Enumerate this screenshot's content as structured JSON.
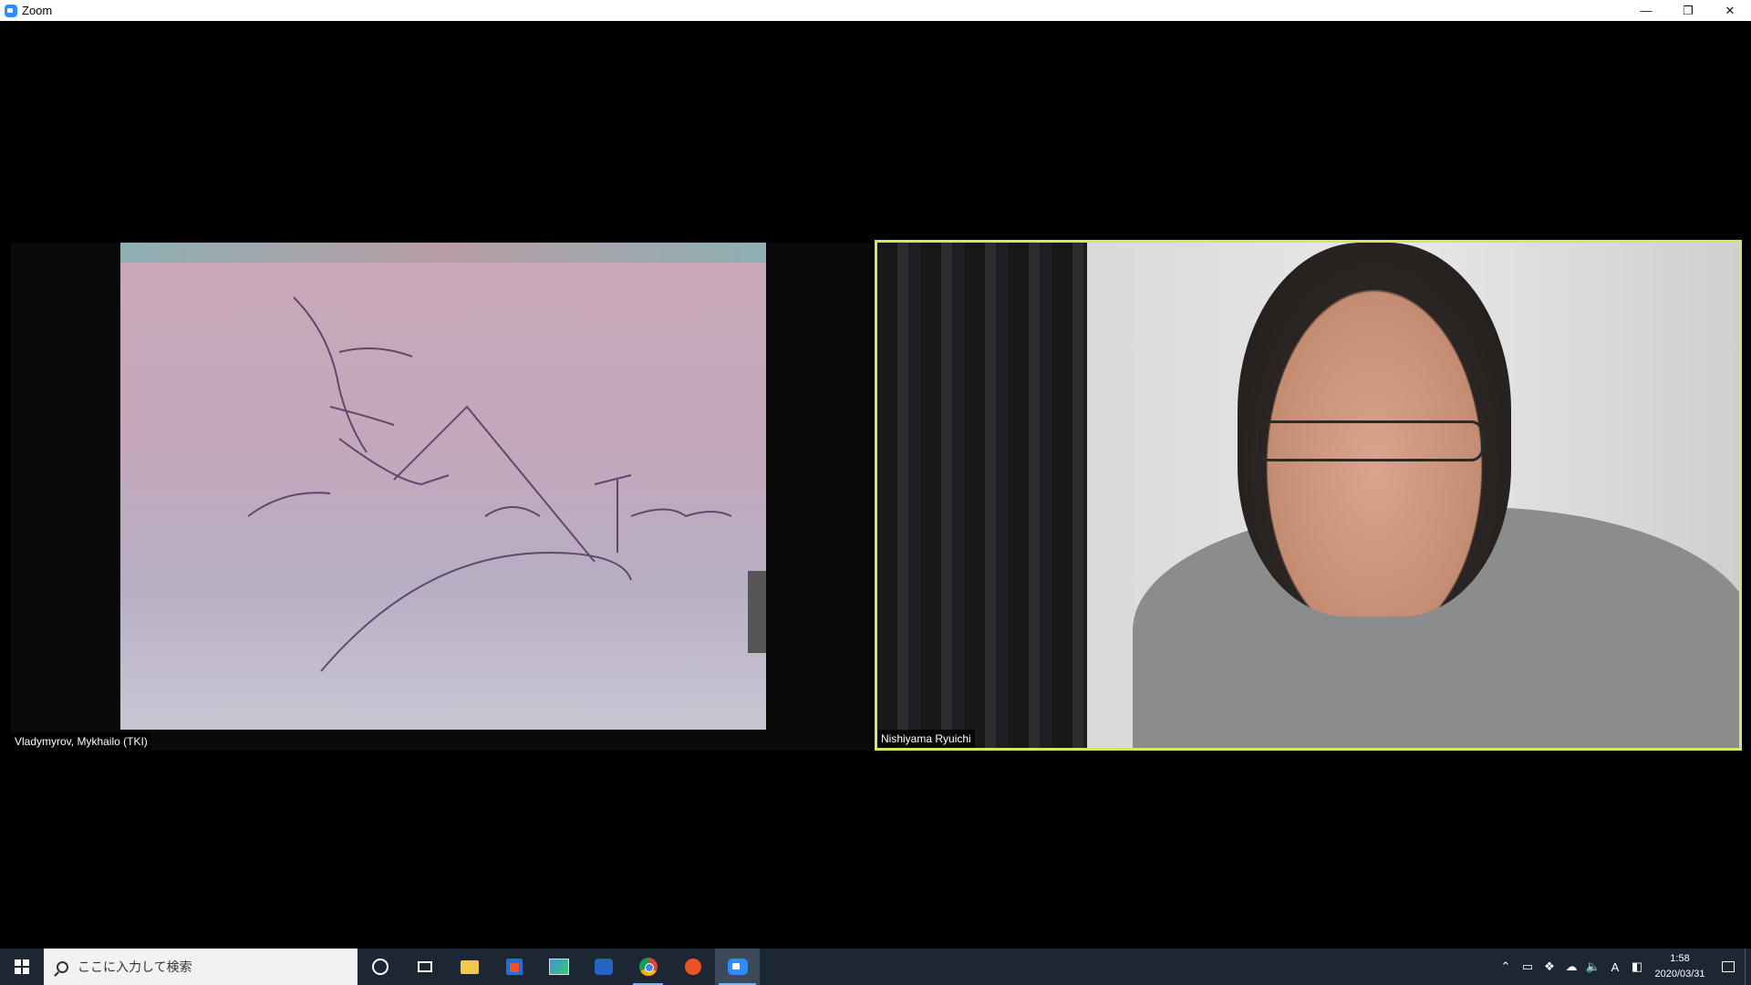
{
  "window": {
    "title": "Zoom",
    "controls": {
      "minimize": "—",
      "restore": "❐",
      "close": "✕"
    }
  },
  "participants": [
    {
      "name": "Vladymyrov, Mykhailo (TKI)",
      "active_speaker": false
    },
    {
      "name": "Nishiyama Ryuichi",
      "active_speaker": true
    }
  ],
  "colors": {
    "active_speaker_border": "#d7e65a",
    "taskbar": "#1c2733",
    "zoom_brand": "#2d8cff"
  },
  "taskbar": {
    "search_placeholder": "ここに入力して検索",
    "pinned_apps": [
      "cortana-icon",
      "task-view-icon",
      "file-explorer-icon",
      "microsoft-store-icon",
      "photos-icon",
      "outlook-icon",
      "chrome-icon",
      "ubuntu-icon",
      "zoom-icon"
    ],
    "tray": {
      "ime_label": "A",
      "time": "1:58",
      "date": "2020/03/31"
    }
  }
}
